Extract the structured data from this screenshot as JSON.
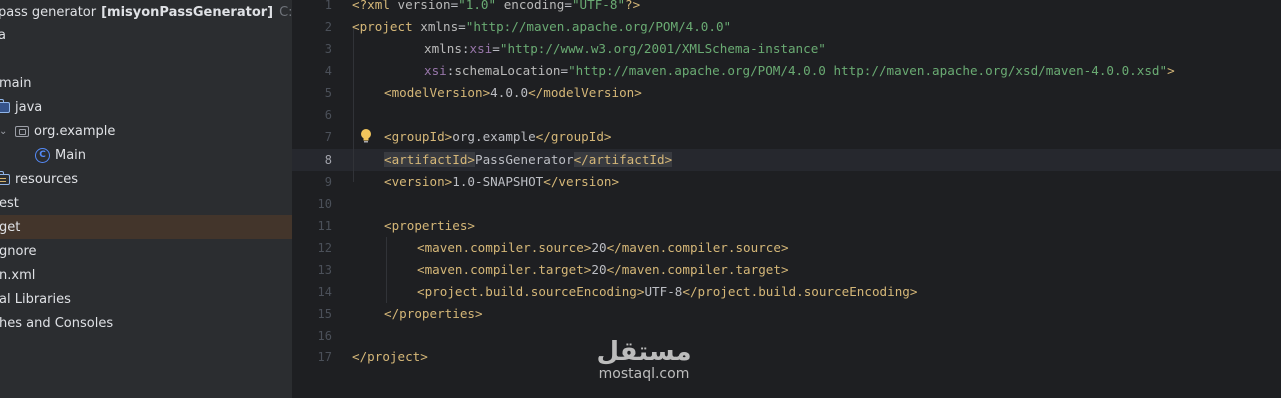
{
  "project_tree": {
    "root": {
      "name": "pass generator",
      "module": "[misyonPassGenerator]",
      "path": "C:\\Us"
    },
    "items": [
      {
        "label": "a"
      },
      {
        "label": "main"
      },
      {
        "label": "java"
      },
      {
        "label": "org.example"
      },
      {
        "label": "Main"
      },
      {
        "label": "resources"
      },
      {
        "label": "est"
      },
      {
        "label": "get"
      },
      {
        "label": "gnore"
      },
      {
        "label": "n.xml"
      },
      {
        "label": "al Libraries"
      },
      {
        "label": "hes and Consoles"
      }
    ],
    "selected_item": "get"
  },
  "editor": {
    "current_line": 8,
    "line_numbers": [
      "1",
      "2",
      "3",
      "4",
      "5",
      "6",
      "7",
      "8",
      "9",
      "10",
      "11",
      "12",
      "13",
      "14",
      "15",
      "16",
      "17"
    ],
    "lines": {
      "l1": {
        "open": "<?xml ",
        "a1": "version",
        "eq1": "=",
        "v1": "\"1.0\"",
        "sp": " ",
        "a2": "encoding",
        "eq2": "=",
        "v2": "\"UTF-8\"",
        "close": "?>"
      },
      "l2": {
        "open": "<project ",
        "a1": "xmlns",
        "eq1": "=",
        "v1": "\"http://maven.apache.org/POM/4.0.0\""
      },
      "l3": {
        "ns": "xmlns",
        "colon": ":",
        "a1": "xsi",
        "eq1": "=",
        "v1": "\"http://www.w3.org/2001/XMLSchema-instance\""
      },
      "l4": {
        "ns": "xsi",
        "colon": ":",
        "a1": "schemaLocation",
        "eq1": "=",
        "v1": "\"http://maven.apache.org/POM/4.0.0 http://maven.apache.org/xsd/maven-4.0.0.xsd\"",
        "close": ">"
      },
      "l5": {
        "open": "<modelVersion>",
        "text": "4.0.0",
        "close": "</modelVersion>"
      },
      "l7": {
        "open": "<groupId>",
        "text": "org.example",
        "close": "</groupId>"
      },
      "l8": {
        "open": "<artifactId>",
        "text": "PassGenerator",
        "close": "</artifactId>"
      },
      "l9": {
        "open": "<version>",
        "text": "1.0-SNAPSHOT",
        "close": "</version>"
      },
      "l11": {
        "open": "<properties>"
      },
      "l12": {
        "open": "<maven.compiler.source>",
        "text": "20",
        "close": "</maven.compiler.source>"
      },
      "l13": {
        "open": "<maven.compiler.target>",
        "text": "20",
        "close": "</maven.compiler.target>"
      },
      "l14": {
        "open": "<project.build.sourceEncoding>",
        "text": "UTF-8",
        "close": "</project.build.sourceEncoding>"
      },
      "l15": {
        "close": "</properties>"
      },
      "l17": {
        "close": "</project>"
      }
    }
  },
  "watermark": {
    "arabic": "مستقل",
    "latin": "mostaql.com"
  },
  "colors": {
    "tag": "#d5b778",
    "string": "#6aab73",
    "namespace": "#9876aa",
    "selection": "#43352b"
  }
}
